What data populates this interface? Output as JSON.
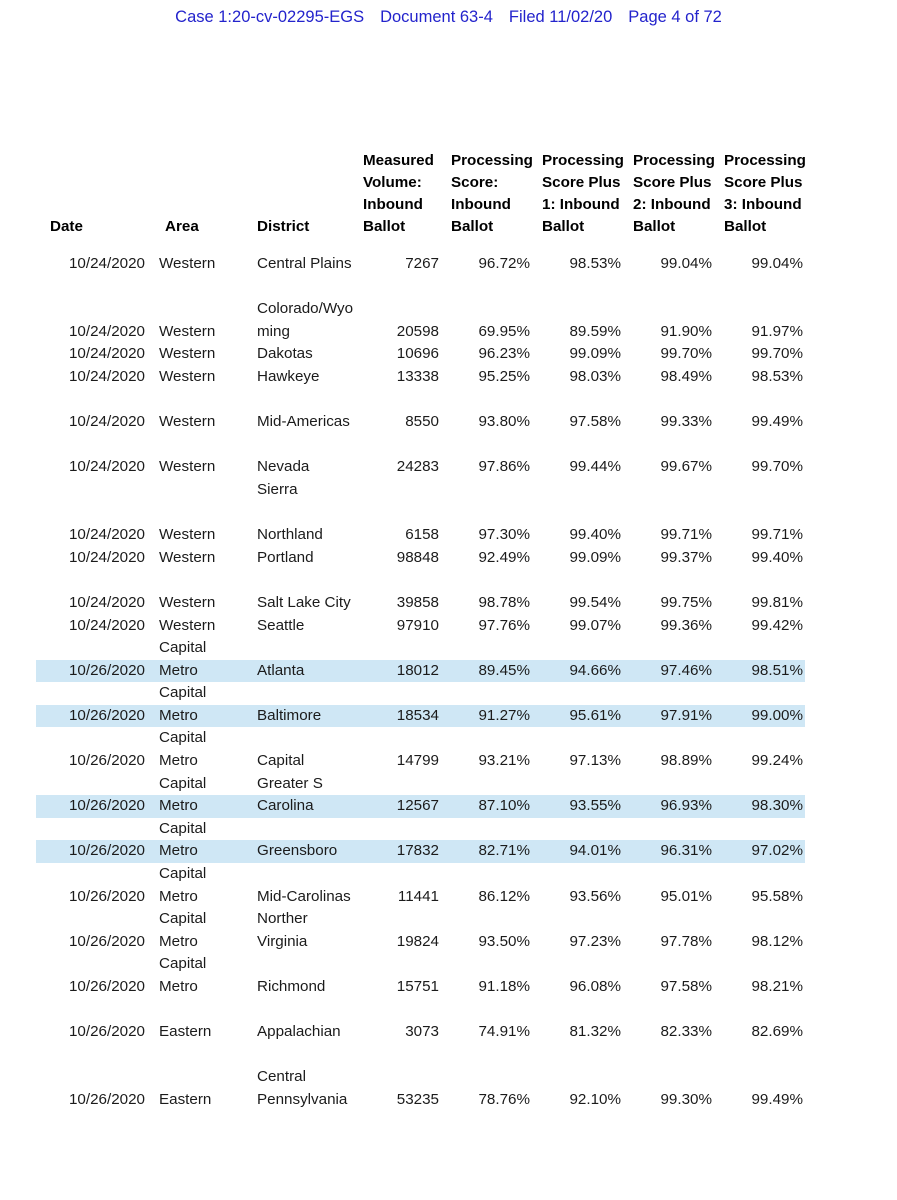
{
  "ecf_header": {
    "case": "Case 1:20-cv-02295-EGS",
    "document": "Document 63-4",
    "filed": "Filed 11/02/20",
    "page": "Page 4 of 72"
  },
  "colors": {
    "header_text": "#2323cc",
    "highlight_row": "#cfe7f5",
    "body_text": "#1b1b1b"
  },
  "table": {
    "columns": [
      {
        "key": "date",
        "label": "Date"
      },
      {
        "key": "area",
        "label": "Area"
      },
      {
        "key": "district",
        "label": "District"
      },
      {
        "key": "volume",
        "label": "Measured Volume: Inbound Ballot",
        "lines": [
          "Measured",
          "Volume:",
          "Inbound",
          "Ballot"
        ]
      },
      {
        "key": "score",
        "label": "Processing Score: Inbound Ballot",
        "lines": [
          "Processing",
          "Score:",
          "Inbound",
          "Ballot"
        ]
      },
      {
        "key": "plus1",
        "label": "Processing Score Plus 1: Inbound Ballot",
        "lines": [
          "Processing",
          "Score Plus",
          "1: Inbound",
          "Ballot"
        ]
      },
      {
        "key": "plus2",
        "label": "Processing Score Plus 2: Inbound Ballot",
        "lines": [
          "Processing",
          "Score Plus",
          "2: Inbound",
          "Ballot"
        ]
      },
      {
        "key": "plus3",
        "label": "Processing Score Plus 3: Inbound Ballot",
        "lines": [
          "Processing",
          "Score Plus",
          "3: Inbound",
          "Ballot"
        ]
      }
    ],
    "rows": [
      {
        "date": "10/24/2020",
        "area": "Western",
        "area_wrap": "",
        "district": "Central Plains",
        "district_wrap": "",
        "volume": "7267",
        "score": "96.72%",
        "plus1": "98.53%",
        "plus2": "99.04%",
        "plus3": "99.04%",
        "highlight": false,
        "gap_before": 0
      },
      {
        "date": "10/24/2020",
        "area": "Western",
        "area_wrap": "",
        "district": "ming",
        "district_wrap": "Colorado/Wyo",
        "volume": "20598",
        "score": "69.95%",
        "plus1": "89.59%",
        "plus2": "91.90%",
        "plus3": "91.97%",
        "highlight": false,
        "gap_before": 1
      },
      {
        "date": "10/24/2020",
        "area": "Western",
        "area_wrap": "",
        "district": "Dakotas",
        "district_wrap": "",
        "volume": "10696",
        "score": "96.23%",
        "plus1": "99.09%",
        "plus2": "99.70%",
        "plus3": "99.70%",
        "highlight": false,
        "gap_before": 0
      },
      {
        "date": "10/24/2020",
        "area": "Western",
        "area_wrap": "",
        "district": "Hawkeye",
        "district_wrap": "",
        "volume": "13338",
        "score": "95.25%",
        "plus1": "98.03%",
        "plus2": "98.49%",
        "plus3": "98.53%",
        "highlight": false,
        "gap_before": 0
      },
      {
        "date": "10/24/2020",
        "area": "Western",
        "area_wrap": "",
        "district": "Mid-Americas",
        "district_wrap": "",
        "volume": "8550",
        "score": "93.80%",
        "plus1": "97.58%",
        "plus2": "99.33%",
        "plus3": "99.49%",
        "highlight": false,
        "gap_before": 1
      },
      {
        "date": "10/24/2020",
        "area": "Western",
        "area_wrap": "",
        "district": "Nevada Sierra",
        "district_wrap": "",
        "volume": "24283",
        "score": "97.86%",
        "plus1": "99.44%",
        "plus2": "99.67%",
        "plus3": "99.70%",
        "highlight": false,
        "gap_before": 1
      },
      {
        "date": "10/24/2020",
        "area": "Western",
        "area_wrap": "",
        "district": "Northland",
        "district_wrap": "",
        "volume": "6158",
        "score": "97.30%",
        "plus1": "99.40%",
        "plus2": "99.71%",
        "plus3": "99.71%",
        "highlight": false,
        "gap_before": 1
      },
      {
        "date": "10/24/2020",
        "area": "Western",
        "area_wrap": "",
        "district": "Portland",
        "district_wrap": "",
        "volume": "98848",
        "score": "92.49%",
        "plus1": "99.09%",
        "plus2": "99.37%",
        "plus3": "99.40%",
        "highlight": false,
        "gap_before": 0
      },
      {
        "date": "10/24/2020",
        "area": "Western",
        "area_wrap": "",
        "district": "Salt Lake City",
        "district_wrap": "",
        "volume": "39858",
        "score": "98.78%",
        "plus1": "99.54%",
        "plus2": "99.75%",
        "plus3": "99.81%",
        "highlight": false,
        "gap_before": 1
      },
      {
        "date": "10/24/2020",
        "area": "Western",
        "area_wrap": "",
        "district": "Seattle",
        "district_wrap": "",
        "volume": "97910",
        "score": "97.76%",
        "plus1": "99.07%",
        "plus2": "99.36%",
        "plus3": "99.42%",
        "highlight": false,
        "gap_before": 0
      },
      {
        "date": "10/26/2020",
        "area": "Metro",
        "area_wrap": "Capital",
        "district": "Atlanta",
        "district_wrap": "",
        "volume": "18012",
        "score": "89.45%",
        "plus1": "94.66%",
        "plus2": "97.46%",
        "plus3": "98.51%",
        "highlight": true,
        "gap_before": 0
      },
      {
        "date": "10/26/2020",
        "area": "Metro",
        "area_wrap": "Capital",
        "district": "Baltimore",
        "district_wrap": "",
        "volume": "18534",
        "score": "91.27%",
        "plus1": "95.61%",
        "plus2": "97.91%",
        "plus3": "99.00%",
        "highlight": true,
        "gap_before": 0
      },
      {
        "date": "10/26/2020",
        "area": "Metro",
        "area_wrap": "Capital",
        "district": "Capital",
        "district_wrap": "",
        "volume": "14799",
        "score": "93.21%",
        "plus1": "97.13%",
        "plus2": "98.89%",
        "plus3": "99.24%",
        "highlight": false,
        "gap_before": 0
      },
      {
        "date": "10/26/2020",
        "area": "Metro",
        "area_wrap": "Capital",
        "district": "Carolina",
        "district_wrap": "Greater S",
        "volume": "12567",
        "score": "87.10%",
        "plus1": "93.55%",
        "plus2": "96.93%",
        "plus3": "98.30%",
        "highlight": true,
        "gap_before": 0
      },
      {
        "date": "10/26/2020",
        "area": "Metro",
        "area_wrap": "Capital",
        "district": "Greensboro",
        "district_wrap": "",
        "volume": "17832",
        "score": "82.71%",
        "plus1": "94.01%",
        "plus2": "96.31%",
        "plus3": "97.02%",
        "highlight": true,
        "gap_before": 0
      },
      {
        "date": "10/26/2020",
        "area": "Metro",
        "area_wrap": "Capital",
        "district": "Mid-Carolinas",
        "district_wrap": "",
        "volume": "11441",
        "score": "86.12%",
        "plus1": "93.56%",
        "plus2": "95.01%",
        "plus3": "95.58%",
        "highlight": false,
        "gap_before": 0
      },
      {
        "date": "10/26/2020",
        "area": "Metro",
        "area_wrap": "Capital",
        "district": "Virginia",
        "district_wrap": "Norther",
        "volume": "19824",
        "score": "93.50%",
        "plus1": "97.23%",
        "plus2": "97.78%",
        "plus3": "98.12%",
        "highlight": false,
        "gap_before": 0
      },
      {
        "date": "10/26/2020",
        "area": "Metro",
        "area_wrap": "Capital",
        "district": "Richmond",
        "district_wrap": "",
        "volume": "15751",
        "score": "91.18%",
        "plus1": "96.08%",
        "plus2": "97.58%",
        "plus3": "98.21%",
        "highlight": false,
        "gap_before": 0
      },
      {
        "date": "10/26/2020",
        "area": "Eastern",
        "area_wrap": "",
        "district": "Appalachian",
        "district_wrap": "",
        "volume": "3073",
        "score": "74.91%",
        "plus1": "81.32%",
        "plus2": "82.33%",
        "plus3": "82.69%",
        "highlight": false,
        "gap_before": 1
      },
      {
        "date": "10/26/2020",
        "area": "Eastern",
        "area_wrap": "",
        "district": "Pennsylvania",
        "district_wrap": "Central",
        "volume": "53235",
        "score": "78.76%",
        "plus1": "92.10%",
        "plus2": "99.30%",
        "plus3": "99.49%",
        "highlight": false,
        "gap_before": 1
      }
    ]
  }
}
